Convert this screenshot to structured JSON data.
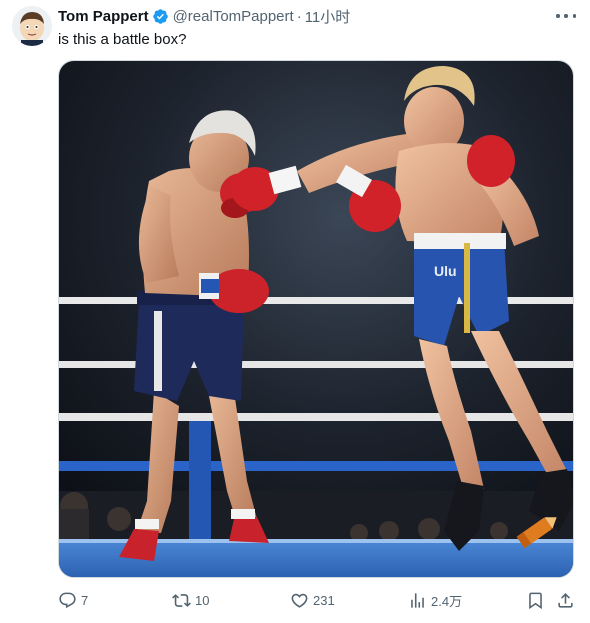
{
  "post": {
    "author_name": "Tom Pappert",
    "author_handle": "@realTomPappert",
    "separator": "·",
    "time": "11小时",
    "text": "is this a battle box?"
  },
  "media": {
    "logo_text": "Ulu",
    "icon": "pencil-crayon-watermark-icon"
  },
  "actions": {
    "reply_count": "7",
    "retweet_count": "10",
    "like_count": "231",
    "views_count": "2.4万"
  },
  "colors": {
    "text_primary": "#0f1419",
    "text_secondary": "#536471",
    "verified_blue": "#1d9bf0",
    "ring_blue": "#2a64c8"
  }
}
